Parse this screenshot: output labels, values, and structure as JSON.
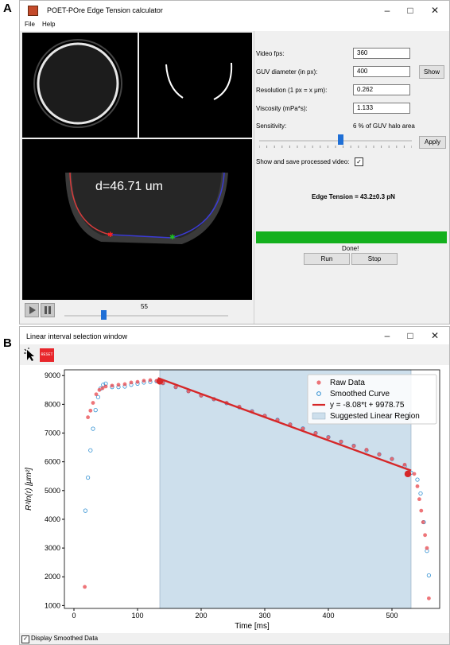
{
  "panel_a_label": "A",
  "panel_b_label": "B",
  "main_window": {
    "title": "POET-POre Edge Tension calculator",
    "menu": [
      "File",
      "Help"
    ],
    "overlay_text": "d=46.71 um",
    "frame_number": "55",
    "fields": [
      {
        "label": "Video fps:",
        "value": "360"
      },
      {
        "label": "GUV diameter (in px):",
        "value": "400"
      },
      {
        "label": "Resolution (1 px = x μm):",
        "value": "0.262"
      },
      {
        "label": "Viscosity (mPa*s):",
        "value": "1.133"
      }
    ],
    "show_button": "Show",
    "sensitivity_label": "Sensitivity:",
    "sensitivity_value": "6 % of GUV halo area",
    "sensitivity_level": 0.53,
    "apply_button": "Apply",
    "checkbox_label": "Show and save processed video:",
    "checkbox_checked": true,
    "result": "Edge Tension = 43.2±0.3 pN",
    "progress": 1.0,
    "progress_color": "#13b01d",
    "status": "Done!",
    "run_button": "Run",
    "stop_button": "Stop",
    "video_slider_level": 0.24
  },
  "plot_window": {
    "title": "Linear interval selection window",
    "reset_button": "RESET",
    "checkbox_label": "Display Smoothed Data",
    "checkbox_checked": true
  },
  "chart_data": {
    "type": "scatter",
    "xlabel": "Time [ms]",
    "ylabel": "R²ln(r) [μm²]",
    "xlim": [
      -15,
      575
    ],
    "ylim": [
      900,
      9200
    ],
    "xticks": [
      0,
      100,
      200,
      300,
      400,
      500
    ],
    "yticks": [
      1000,
      2000,
      3000,
      4000,
      5000,
      6000,
      7000,
      8000,
      9000
    ],
    "legend_placement": "top-right",
    "raw_color": "#e8474c",
    "smooth_color": "#2d8ed1",
    "fit_color": "#d62728",
    "region_color": "#cddfec",
    "series": [
      {
        "name": "Raw Data",
        "x": [
          17,
          22,
          26,
          30,
          35,
          40,
          45,
          50,
          60,
          70,
          80,
          90,
          100,
          110,
          120,
          130,
          140,
          160,
          180,
          200,
          220,
          240,
          260,
          280,
          300,
          320,
          340,
          360,
          380,
          400,
          420,
          440,
          460,
          480,
          500,
          520,
          535,
          540,
          543,
          546,
          549,
          552,
          555,
          558
        ],
        "y": [
          1650,
          7550,
          7780,
          8050,
          8350,
          8500,
          8560,
          8620,
          8650,
          8680,
          8700,
          8760,
          8780,
          8820,
          8840,
          8820,
          8740,
          8600,
          8450,
          8300,
          8180,
          8050,
          7920,
          7750,
          7600,
          7450,
          7300,
          7150,
          7000,
          6850,
          6700,
          6550,
          6420,
          6260,
          6100,
          5900,
          5580,
          5150,
          4700,
          4300,
          3900,
          3450,
          3000,
          1250
        ]
      },
      {
        "name": "Smoothed Curve",
        "x": [
          18,
          22,
          26,
          30,
          34,
          38,
          42,
          46,
          50,
          60,
          70,
          80,
          90,
          100,
          110,
          120,
          130,
          140,
          160,
          180,
          200,
          220,
          240,
          260,
          280,
          300,
          320,
          340,
          360,
          380,
          400,
          420,
          440,
          460,
          480,
          500,
          520,
          530,
          540,
          545,
          550,
          555,
          558
        ],
        "y": [
          4300,
          5450,
          6400,
          7150,
          7800,
          8250,
          8550,
          8680,
          8720,
          8600,
          8600,
          8620,
          8680,
          8720,
          8760,
          8780,
          8800,
          8740,
          8600,
          8460,
          8310,
          8180,
          8040,
          7900,
          7760,
          7600,
          7460,
          7300,
          7160,
          7000,
          6860,
          6700,
          6560,
          6400,
          6260,
          6100,
          5850,
          5620,
          5380,
          4900,
          3900,
          2900,
          2050
        ]
      },
      {
        "name": "y = -8.08*t + 9978.75",
        "x": [
          132,
          530
        ],
        "y": [
          8912,
          5696
        ]
      },
      {
        "name": "Suggested Linear Region",
        "x": [
          135,
          530
        ]
      }
    ],
    "selected_points": [
      {
        "x": 135,
        "y": 8800
      },
      {
        "x": 525,
        "y": 5580
      }
    ]
  }
}
